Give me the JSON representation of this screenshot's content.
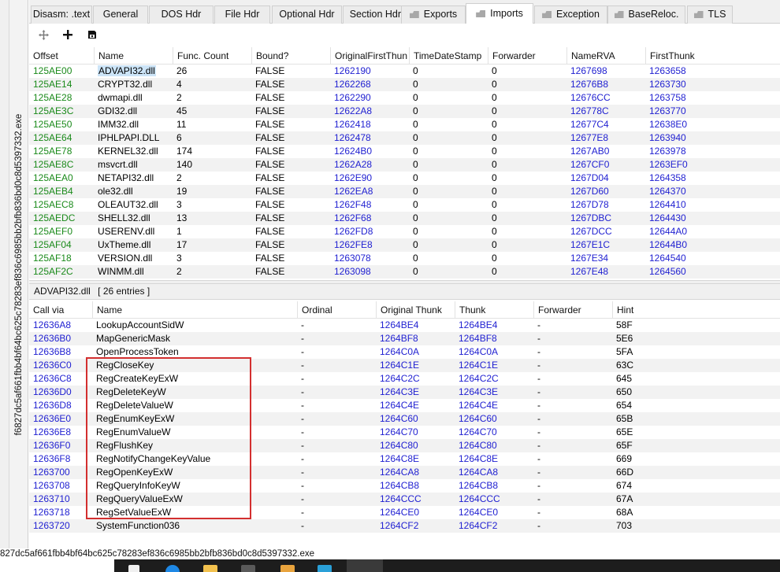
{
  "side_label": "f6827dc5af661fbb4bf64bc625c78283ef836c6985bb2bfb836bd0c8d5397332.exe",
  "tabs": [
    {
      "label": "Disasm: .text",
      "icon": false,
      "active": false
    },
    {
      "label": "General",
      "icon": false,
      "active": false
    },
    {
      "label": "DOS Hdr",
      "icon": false,
      "active": false
    },
    {
      "label": "File Hdr",
      "icon": false,
      "active": false
    },
    {
      "label": "Optional Hdr",
      "icon": false,
      "active": false
    },
    {
      "label": "Section Hdrs",
      "icon": false,
      "active": false
    },
    {
      "label": "Exports",
      "icon": true,
      "active": false
    },
    {
      "label": "Imports",
      "icon": true,
      "active": true
    },
    {
      "label": "Exception",
      "icon": true,
      "active": false
    },
    {
      "label": "BaseReloc.",
      "icon": true,
      "active": false
    },
    {
      "label": "TLS",
      "icon": true,
      "active": false
    }
  ],
  "toolbar": {
    "move_icon": "move-icon",
    "add_icon": "plus-icon",
    "save_icon": "save-icon"
  },
  "imports_table": {
    "columns": [
      "Offset",
      "Name",
      "Func. Count",
      "Bound?",
      "OriginalFirstThun",
      "TimeDateStamp",
      "Forwarder",
      "NameRVA",
      "FirstThunk"
    ],
    "rows": [
      [
        "125AE00",
        "ADVAPI32.dll",
        "26",
        "FALSE",
        "1262190",
        "0",
        "0",
        "1267698",
        "1263658"
      ],
      [
        "125AE14",
        "CRYPT32.dll",
        "4",
        "FALSE",
        "1262268",
        "0",
        "0",
        "12676B8",
        "1263730"
      ],
      [
        "125AE28",
        "dwmapi.dll",
        "2",
        "FALSE",
        "1262290",
        "0",
        "0",
        "12676CC",
        "1263758"
      ],
      [
        "125AE3C",
        "GDI32.dll",
        "45",
        "FALSE",
        "12622A8",
        "0",
        "0",
        "126778C",
        "1263770"
      ],
      [
        "125AE50",
        "IMM32.dll",
        "11",
        "FALSE",
        "1262418",
        "0",
        "0",
        "12677C4",
        "12638E0"
      ],
      [
        "125AE64",
        "IPHLPAPI.DLL",
        "6",
        "FALSE",
        "1262478",
        "0",
        "0",
        "12677E8",
        "1263940"
      ],
      [
        "125AE78",
        "KERNEL32.dll",
        "174",
        "FALSE",
        "12624B0",
        "0",
        "0",
        "1267AB0",
        "1263978"
      ],
      [
        "125AE8C",
        "msvcrt.dll",
        "140",
        "FALSE",
        "1262A28",
        "0",
        "0",
        "1267CF0",
        "1263EF0"
      ],
      [
        "125AEA0",
        "NETAPI32.dll",
        "2",
        "FALSE",
        "1262E90",
        "0",
        "0",
        "1267D04",
        "1264358"
      ],
      [
        "125AEB4",
        "ole32.dll",
        "19",
        "FALSE",
        "1262EA8",
        "0",
        "0",
        "1267D60",
        "1264370"
      ],
      [
        "125AEC8",
        "OLEAUT32.dll",
        "3",
        "FALSE",
        "1262F48",
        "0",
        "0",
        "1267D78",
        "1264410"
      ],
      [
        "125AEDC",
        "SHELL32.dll",
        "13",
        "FALSE",
        "1262F68",
        "0",
        "0",
        "1267DBC",
        "1264430"
      ],
      [
        "125AEF0",
        "USERENV.dll",
        "1",
        "FALSE",
        "1262FD8",
        "0",
        "0",
        "1267DCC",
        "12644A0"
      ],
      [
        "125AF04",
        "UxTheme.dll",
        "17",
        "FALSE",
        "1262FE8",
        "0",
        "0",
        "1267E1C",
        "12644B0"
      ],
      [
        "125AF18",
        "VERSION.dll",
        "3",
        "FALSE",
        "1263078",
        "0",
        "0",
        "1267E34",
        "1264540"
      ],
      [
        "125AF2C",
        "WINMM.dll",
        "2",
        "FALSE",
        "1263098",
        "0",
        "0",
        "1267E48",
        "1264560"
      ]
    ]
  },
  "summary": {
    "dll": "ADVAPI32.dll",
    "entries": "[ 26 entries ]"
  },
  "functions_table": {
    "columns": [
      "Call via",
      "Name",
      "Ordinal",
      "Original Thunk",
      "Thunk",
      "Forwarder",
      "Hint"
    ],
    "rows": [
      [
        "12636A8",
        "LookupAccountSidW",
        "-",
        "1264BE4",
        "1264BE4",
        "-",
        "58F"
      ],
      [
        "12636B0",
        "MapGenericMask",
        "-",
        "1264BF8",
        "1264BF8",
        "-",
        "5E6"
      ],
      [
        "12636B8",
        "OpenProcessToken",
        "-",
        "1264C0A",
        "1264C0A",
        "-",
        "5FA"
      ],
      [
        "12636C0",
        "RegCloseKey",
        "-",
        "1264C1E",
        "1264C1E",
        "-",
        "63C"
      ],
      [
        "12636C8",
        "RegCreateKeyExW",
        "-",
        "1264C2C",
        "1264C2C",
        "-",
        "645"
      ],
      [
        "12636D0",
        "RegDeleteKeyW",
        "-",
        "1264C3E",
        "1264C3E",
        "-",
        "650"
      ],
      [
        "12636D8",
        "RegDeleteValueW",
        "-",
        "1264C4E",
        "1264C4E",
        "-",
        "654"
      ],
      [
        "12636E0",
        "RegEnumKeyExW",
        "-",
        "1264C60",
        "1264C60",
        "-",
        "65B"
      ],
      [
        "12636E8",
        "RegEnumValueW",
        "-",
        "1264C70",
        "1264C70",
        "-",
        "65E"
      ],
      [
        "12636F0",
        "RegFlushKey",
        "-",
        "1264C80",
        "1264C80",
        "-",
        "65F"
      ],
      [
        "12636F8",
        "RegNotifyChangeKeyValue",
        "-",
        "1264C8E",
        "1264C8E",
        "-",
        "669"
      ],
      [
        "1263700",
        "RegOpenKeyExW",
        "-",
        "1264CA8",
        "1264CA8",
        "-",
        "66D"
      ],
      [
        "1263708",
        "RegQueryInfoKeyW",
        "-",
        "1264CB8",
        "1264CB8",
        "-",
        "674"
      ],
      [
        "1263710",
        "RegQueryValueExW",
        "-",
        "1264CCC",
        "1264CCC",
        "-",
        "67A"
      ],
      [
        "1263718",
        "RegSetValueExW",
        "-",
        "1264CE0",
        "1264CE0",
        "-",
        "68A"
      ],
      [
        "1263720",
        "SystemFunction036",
        "-",
        "1264CF2",
        "1264CF2",
        "-",
        "703"
      ]
    ]
  },
  "status_text": "827dc5af661fbb4bf64bc625c78283ef836c6985bb2bfb836bd0c8d5397332.exe",
  "colors": {
    "offset": "#1a8a1a",
    "rva": "#1f1fd1",
    "highlight_box": "#d32f2f",
    "selection": "#cce4f7"
  }
}
